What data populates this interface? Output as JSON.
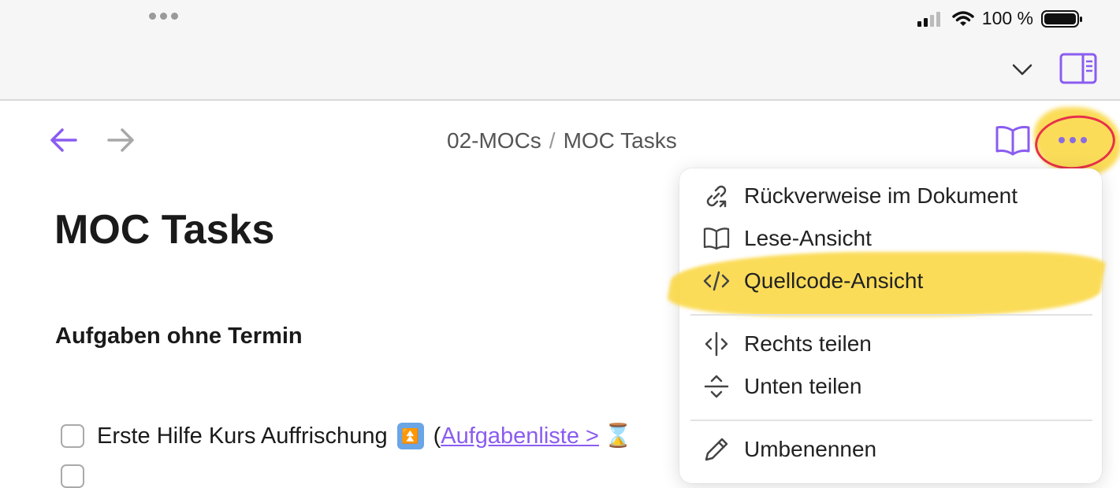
{
  "status": {
    "battery_text": "100 %"
  },
  "breadcrumb": {
    "folder": "02-MOCs",
    "separator": "/",
    "note": "MOC Tasks"
  },
  "page": {
    "title": "MOC Tasks",
    "section_heading": "Aufgaben ohne Termin",
    "task": {
      "text": "Erste Hilfe Kurs Auffrischung",
      "paren_open": "(",
      "link": "Aufgabenliste >"
    }
  },
  "menu": {
    "items": [
      {
        "label": "Rückverweise im Dokument",
        "icon": "backlinks-icon"
      },
      {
        "label": "Lese-Ansicht",
        "icon": "book-icon"
      },
      {
        "label": "Quellcode-Ansicht",
        "icon": "code-icon"
      },
      {
        "label": "Rechts teilen",
        "icon": "split-right-icon"
      },
      {
        "label": "Unten teilen",
        "icon": "split-down-icon"
      },
      {
        "label": "Umbenennen",
        "icon": "pencil-icon"
      }
    ]
  },
  "colors": {
    "accent": "#8a5cf0",
    "highlight": "#fad63c",
    "annotation": "#e8314a"
  }
}
